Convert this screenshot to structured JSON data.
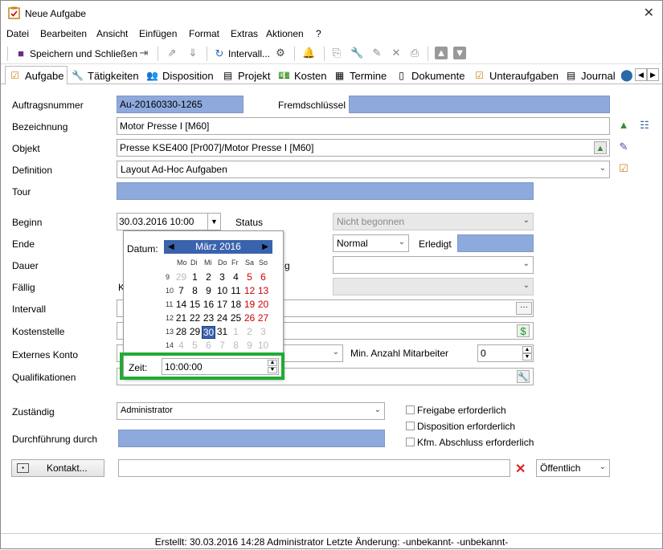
{
  "window": {
    "title": "Neue Aufgabe",
    "close": "✕"
  },
  "menu": [
    "Datei",
    "Bearbeiten",
    "Ansicht",
    "Einfügen",
    "Format",
    "Extras",
    "Aktionen",
    "?"
  ],
  "toolbar": {
    "save": "Speichern und Schließen",
    "interval": "Intervall..."
  },
  "tabs": [
    "Aufgabe",
    "Tätigkeiten",
    "Disposition",
    "Projekt",
    "Kosten",
    "Termine",
    "Dokumente",
    "Unterauf­gaben",
    "Journal"
  ],
  "form": {
    "auftragsnummer_label": "Auftragsnummer",
    "auftragsnummer": "Au-20160330-1265",
    "fremdschluessel_label": "Fremdschlüssel",
    "fremdschluessel": "",
    "bezeichnung_label": "Bezeichnung",
    "bezeichnung": "Motor Presse I [M60]",
    "objekt_label": "Objekt",
    "objekt": "Presse KSE400 [Pr007]/Motor Presse I [M60]",
    "definition_label": "Definition",
    "definition": "Layout Ad-Hoc Aufgaben",
    "tour_label": "Tour",
    "beginn_label": "Beginn",
    "beginn": "30.03.2016 10:00",
    "status_label": "Status",
    "status": "Nicht begonnen",
    "ende_label": "Ende",
    "prio": "Normal",
    "erledigt_label": "Erledigt",
    "dauer_label": "Dauer",
    "faellig_label": "Fällig",
    "faellig_partial": "K",
    "intervall_label": "Intervall",
    "kostenstelle_label": "Kostenstelle",
    "externes_konto_label": "Externes Konto",
    "min_mitarbeiter_label": "Min.  Anzahl Mitarbeiter",
    "min_mitarbeiter": "0",
    "qualifikationen_label": "Qualifikationen",
    "zustaendig_label": "Zuständig",
    "zustaendig": "Administrator",
    "durchfuehrung_label": "Durchführung durch",
    "freigabe": "Freigabe erforderlich",
    "disposition_erf": "Disposition erforderlich",
    "kfm": "Kfm. Abschluss erforderlich",
    "kontakt_btn": "Kontakt...",
    "oeffentlich": "Öffentlich",
    "partial_g": "g",
    "dots": "···"
  },
  "calendar": {
    "datum_label": "Datum:",
    "month": "März 2016",
    "days": [
      "Mo",
      "Di",
      "Mi",
      "Do",
      "Fr",
      "Sa",
      "So"
    ],
    "weeks": [
      "9",
      "10",
      "11",
      "12",
      "13",
      "14"
    ],
    "rows": [
      [
        "29",
        "1",
        "2",
        "3",
        "4",
        "5",
        "6"
      ],
      [
        "7",
        "8",
        "9",
        "10",
        "11",
        "12",
        "13"
      ],
      [
        "14",
        "15",
        "16",
        "17",
        "18",
        "19",
        "20"
      ],
      [
        "21",
        "22",
        "23",
        "24",
        "25",
        "26",
        "27"
      ],
      [
        "28",
        "29",
        "30",
        "31",
        "1",
        "2",
        "3"
      ],
      [
        "4",
        "5",
        "6",
        "7",
        "8",
        "9",
        "10"
      ]
    ],
    "zeit_label": "Zeit:",
    "zeit": "10:00:00"
  },
  "status_bar": "Erstellt: 30.03.2016 14:28 Administrator  Letzte Änderung: -unbekannt- -unbekannt-"
}
